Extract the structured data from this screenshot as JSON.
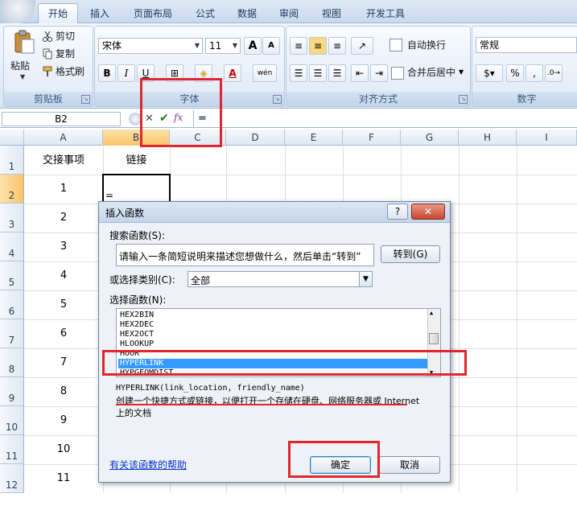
{
  "ribbon": {
    "tabs": [
      "开始",
      "插入",
      "页面布局",
      "公式",
      "数据",
      "审阅",
      "视图",
      "开发工具"
    ],
    "clipboard": {
      "paste": "粘贴",
      "cut": "剪切",
      "copy": "复制",
      "format_painter": "格式刷",
      "label": "剪贴板"
    },
    "font": {
      "name": "宋体",
      "size": "11",
      "grow": "A",
      "shrink": "A",
      "bold": "B",
      "italic": "I",
      "underline": "U",
      "label": "字体",
      "wen": "wén"
    },
    "alignment": {
      "wrap": "自动换行",
      "merge": "合并后居中",
      "label": "对齐方式"
    },
    "number": {
      "format": "常规",
      "percent": "%",
      "comma": ",",
      "label": "数字"
    }
  },
  "formula_bar": {
    "name_box": "B2",
    "fx": "fx",
    "content": "="
  },
  "grid": {
    "columns": [
      "A",
      "B",
      "C",
      "D",
      "E",
      "F",
      "G",
      "H",
      "I"
    ],
    "rows": [
      "1",
      "2",
      "3",
      "4",
      "5",
      "6",
      "7",
      "8",
      "9",
      "10",
      "11",
      "12"
    ],
    "a_values": [
      "交接事项",
      "1",
      "2",
      "3",
      "4",
      "5",
      "6",
      "7",
      "8",
      "9",
      "10",
      "11"
    ],
    "b1": "链接",
    "b2": "="
  },
  "dialog": {
    "title": "插入函数",
    "help": "?",
    "close": "✕",
    "search_label": "搜索函数(S):",
    "search_text": "请输入一条简短说明来描述您想做什么，然后单击“转到”",
    "go": "转到(G)",
    "category_label": "或选择类别(C):",
    "category": "全部",
    "select_label": "选择函数(N):",
    "functions": [
      "HEX2BIN",
      "HEX2DEC",
      "HEX2OCT",
      "HLOOKUP",
      "HOUR",
      "HYPERLINK",
      "HYPGEOMDIST"
    ],
    "selected": "HYPERLINK",
    "signature": "HYPERLINK(link_location, friendly_name)",
    "description": "创建一个快捷方式或链接，以便打开一个存储在硬盘、网络服务器或 Internet 上的文档",
    "help_link": "有关该函数的帮助",
    "ok": "确定",
    "cancel": "取消"
  }
}
